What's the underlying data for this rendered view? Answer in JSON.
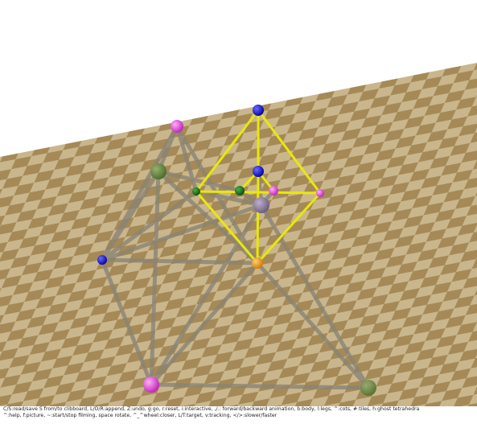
{
  "colors": {
    "background": "#ffffff",
    "tile_light": "#c9b68d",
    "tile_dark": "#a58a57",
    "grey_strut": "#8a8474",
    "yellow_strut": "#e8e80a",
    "magenta_ball": "#e040d8",
    "green_ball": "#5a7a3a",
    "dark_green_ball": "#1e6a1e",
    "blue_ball": "#0a0ad0",
    "orange_ball": "#f0a020",
    "purple_ball": "#8a7a9a"
  },
  "help": {
    "line1": "C/S:read/save S from/to clibboard, L/O/R:append, Z:undo, g:go, r:reset, i:interactive, ,/.: forward/backward animation, b:body, l:legs, ^:cots, #:tiles, h:ghost tetrahedra",
    "line2": "^:help, f:picture, ~:start/stop filming, space rotate, ^_^wheel:closer, L/T:target, v:tracking, </>:slower/faster"
  }
}
